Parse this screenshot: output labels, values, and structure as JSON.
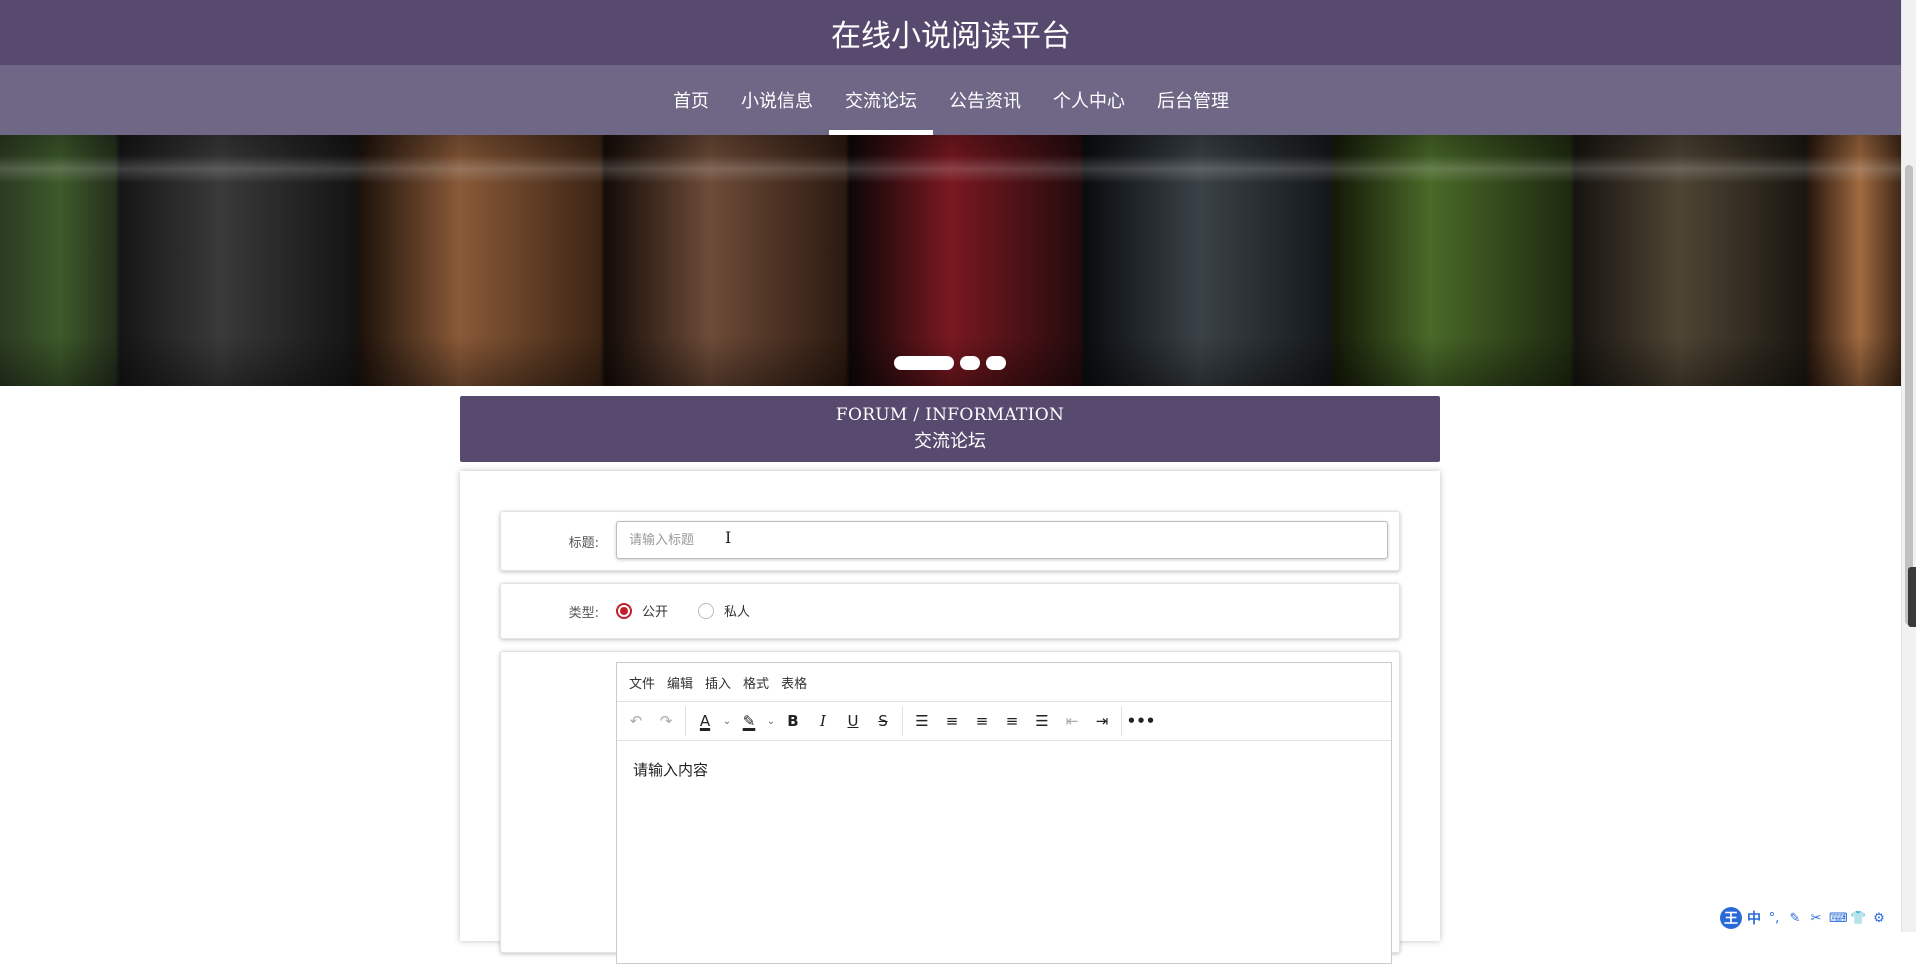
{
  "header": {
    "title": "在线小说阅读平台"
  },
  "nav": {
    "items": [
      {
        "label": "首页"
      },
      {
        "label": "小说信息"
      },
      {
        "label": "交流论坛",
        "active": true
      },
      {
        "label": "公告资讯"
      },
      {
        "label": "个人中心"
      },
      {
        "label": "后台管理"
      }
    ]
  },
  "banner": {
    "slide_count": 3,
    "active_slide": 1
  },
  "section": {
    "title_en": "FORUM / INFORMATION",
    "title_cn": "交流论坛"
  },
  "form": {
    "title_label": "标题:",
    "title_placeholder": "请输入标题",
    "title_value": "",
    "type_label": "类型:",
    "type_options": [
      {
        "label": "公开",
        "checked": true
      },
      {
        "label": "私人",
        "checked": false
      }
    ]
  },
  "editor": {
    "menu": [
      "文件",
      "编辑",
      "插入",
      "格式",
      "表格"
    ],
    "toolbar_icons": [
      "undo-icon",
      "redo-icon",
      "font-color-icon",
      "highlight-color-icon",
      "bold-icon",
      "italic-icon",
      "underline-icon",
      "strikethrough-icon",
      "line-height-icon",
      "align-left-icon",
      "align-center-icon",
      "align-right-icon",
      "align-justify-icon",
      "outdent-icon",
      "indent-icon",
      "more-icon"
    ],
    "content_placeholder": "请输入内容"
  },
  "ime": {
    "logo": "王",
    "mode": "中"
  },
  "colors": {
    "header_bg": "#574a6e",
    "nav_bg": "#6f6786",
    "section_bg": "#574a6e",
    "radio_accent": "#c0202b"
  }
}
